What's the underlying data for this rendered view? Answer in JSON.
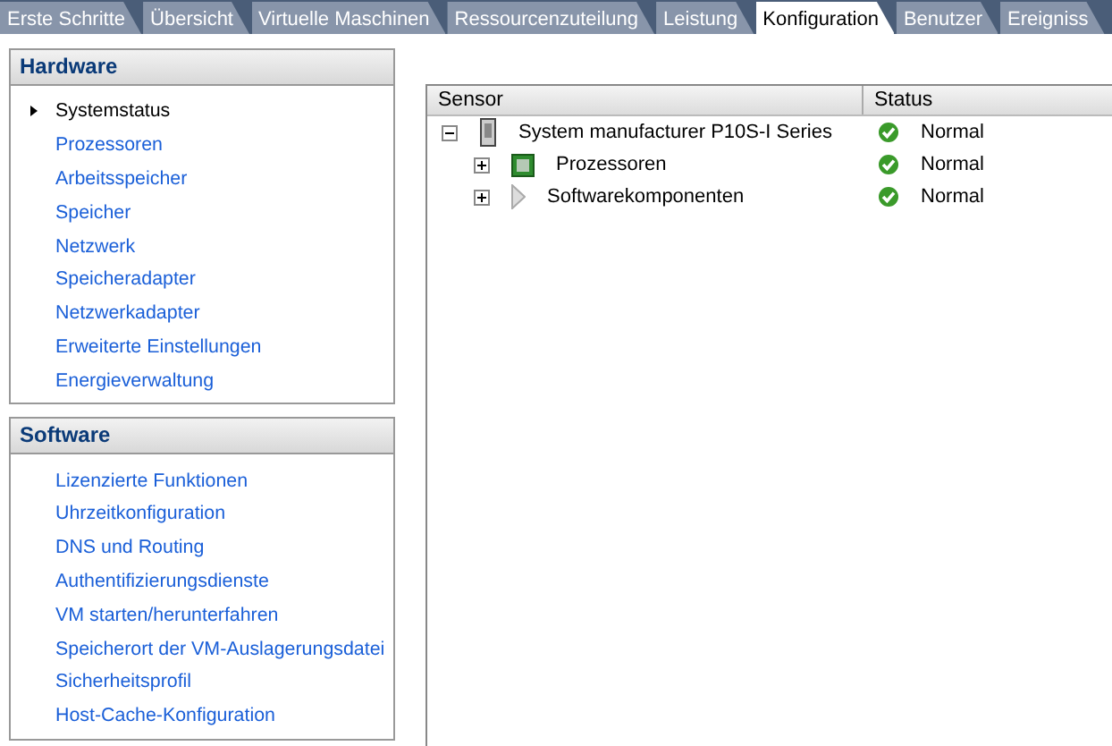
{
  "tabs": [
    {
      "label": "Erste Schritte",
      "selected": false
    },
    {
      "label": "Übersicht",
      "selected": false
    },
    {
      "label": "Virtuelle Maschinen",
      "selected": false
    },
    {
      "label": "Ressourcenzuteilung",
      "selected": false
    },
    {
      "label": "Leistung",
      "selected": false
    },
    {
      "label": "Konfiguration",
      "selected": true
    },
    {
      "label": "Benutzer",
      "selected": false
    },
    {
      "label": "Ereigniss",
      "selected": false
    }
  ],
  "sections": [
    {
      "title": "Hardware",
      "items": [
        {
          "label": "Systemstatus",
          "selected": true
        },
        {
          "label": "Prozessoren",
          "selected": false
        },
        {
          "label": "Arbeitsspeicher",
          "selected": false
        },
        {
          "label": "Speicher",
          "selected": false
        },
        {
          "label": "Netzwerk",
          "selected": false
        },
        {
          "label": "Speicheradapter",
          "selected": false
        },
        {
          "label": "Netzwerkadapter",
          "selected": false
        },
        {
          "label": "Erweiterte Einstellungen",
          "selected": false
        },
        {
          "label": "Energieverwaltung",
          "selected": false
        }
      ]
    },
    {
      "title": "Software",
      "items": [
        {
          "label": "Lizenzierte Funktionen",
          "selected": false
        },
        {
          "label": "Uhrzeitkonfiguration",
          "selected": false
        },
        {
          "label": "DNS und Routing",
          "selected": false
        },
        {
          "label": "Authentifizierungsdienste",
          "selected": false
        },
        {
          "label": "VM starten/herunterfahren",
          "selected": false
        },
        {
          "label": "Speicherort der VM-Auslagerungsdatei",
          "selected": false
        },
        {
          "label": "Sicherheitsprofil",
          "selected": false
        },
        {
          "label": "Host-Cache-Konfiguration",
          "selected": false
        }
      ]
    }
  ],
  "table": {
    "columns": [
      "Sensor",
      "Status"
    ],
    "rows": [
      {
        "sensor": "System manufacturer P10S-I Series",
        "kind": "server",
        "status": "Normal",
        "expanded": true,
        "children": [
          {
            "sensor": "Prozessoren",
            "kind": "chip",
            "status": "Normal",
            "expanded": false
          },
          {
            "sensor": "Softwarekomponenten",
            "kind": "software",
            "status": "Normal",
            "expanded": false
          }
        ]
      }
    ]
  }
}
